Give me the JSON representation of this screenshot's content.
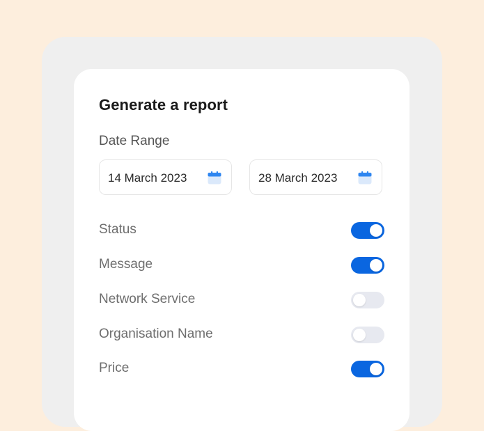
{
  "report": {
    "title": "Generate a report",
    "date_range_label": "Date Range",
    "start_date": "14 March 2023",
    "end_date": "28 March 2023",
    "calendar_icon": "calendar-icon",
    "accent_color": "#0a66e0",
    "options": [
      {
        "label": "Status",
        "enabled": true
      },
      {
        "label": "Message",
        "enabled": true
      },
      {
        "label": "Network Service",
        "enabled": false
      },
      {
        "label": "Organisation Name",
        "enabled": false
      },
      {
        "label": "Price",
        "enabled": true
      }
    ]
  }
}
